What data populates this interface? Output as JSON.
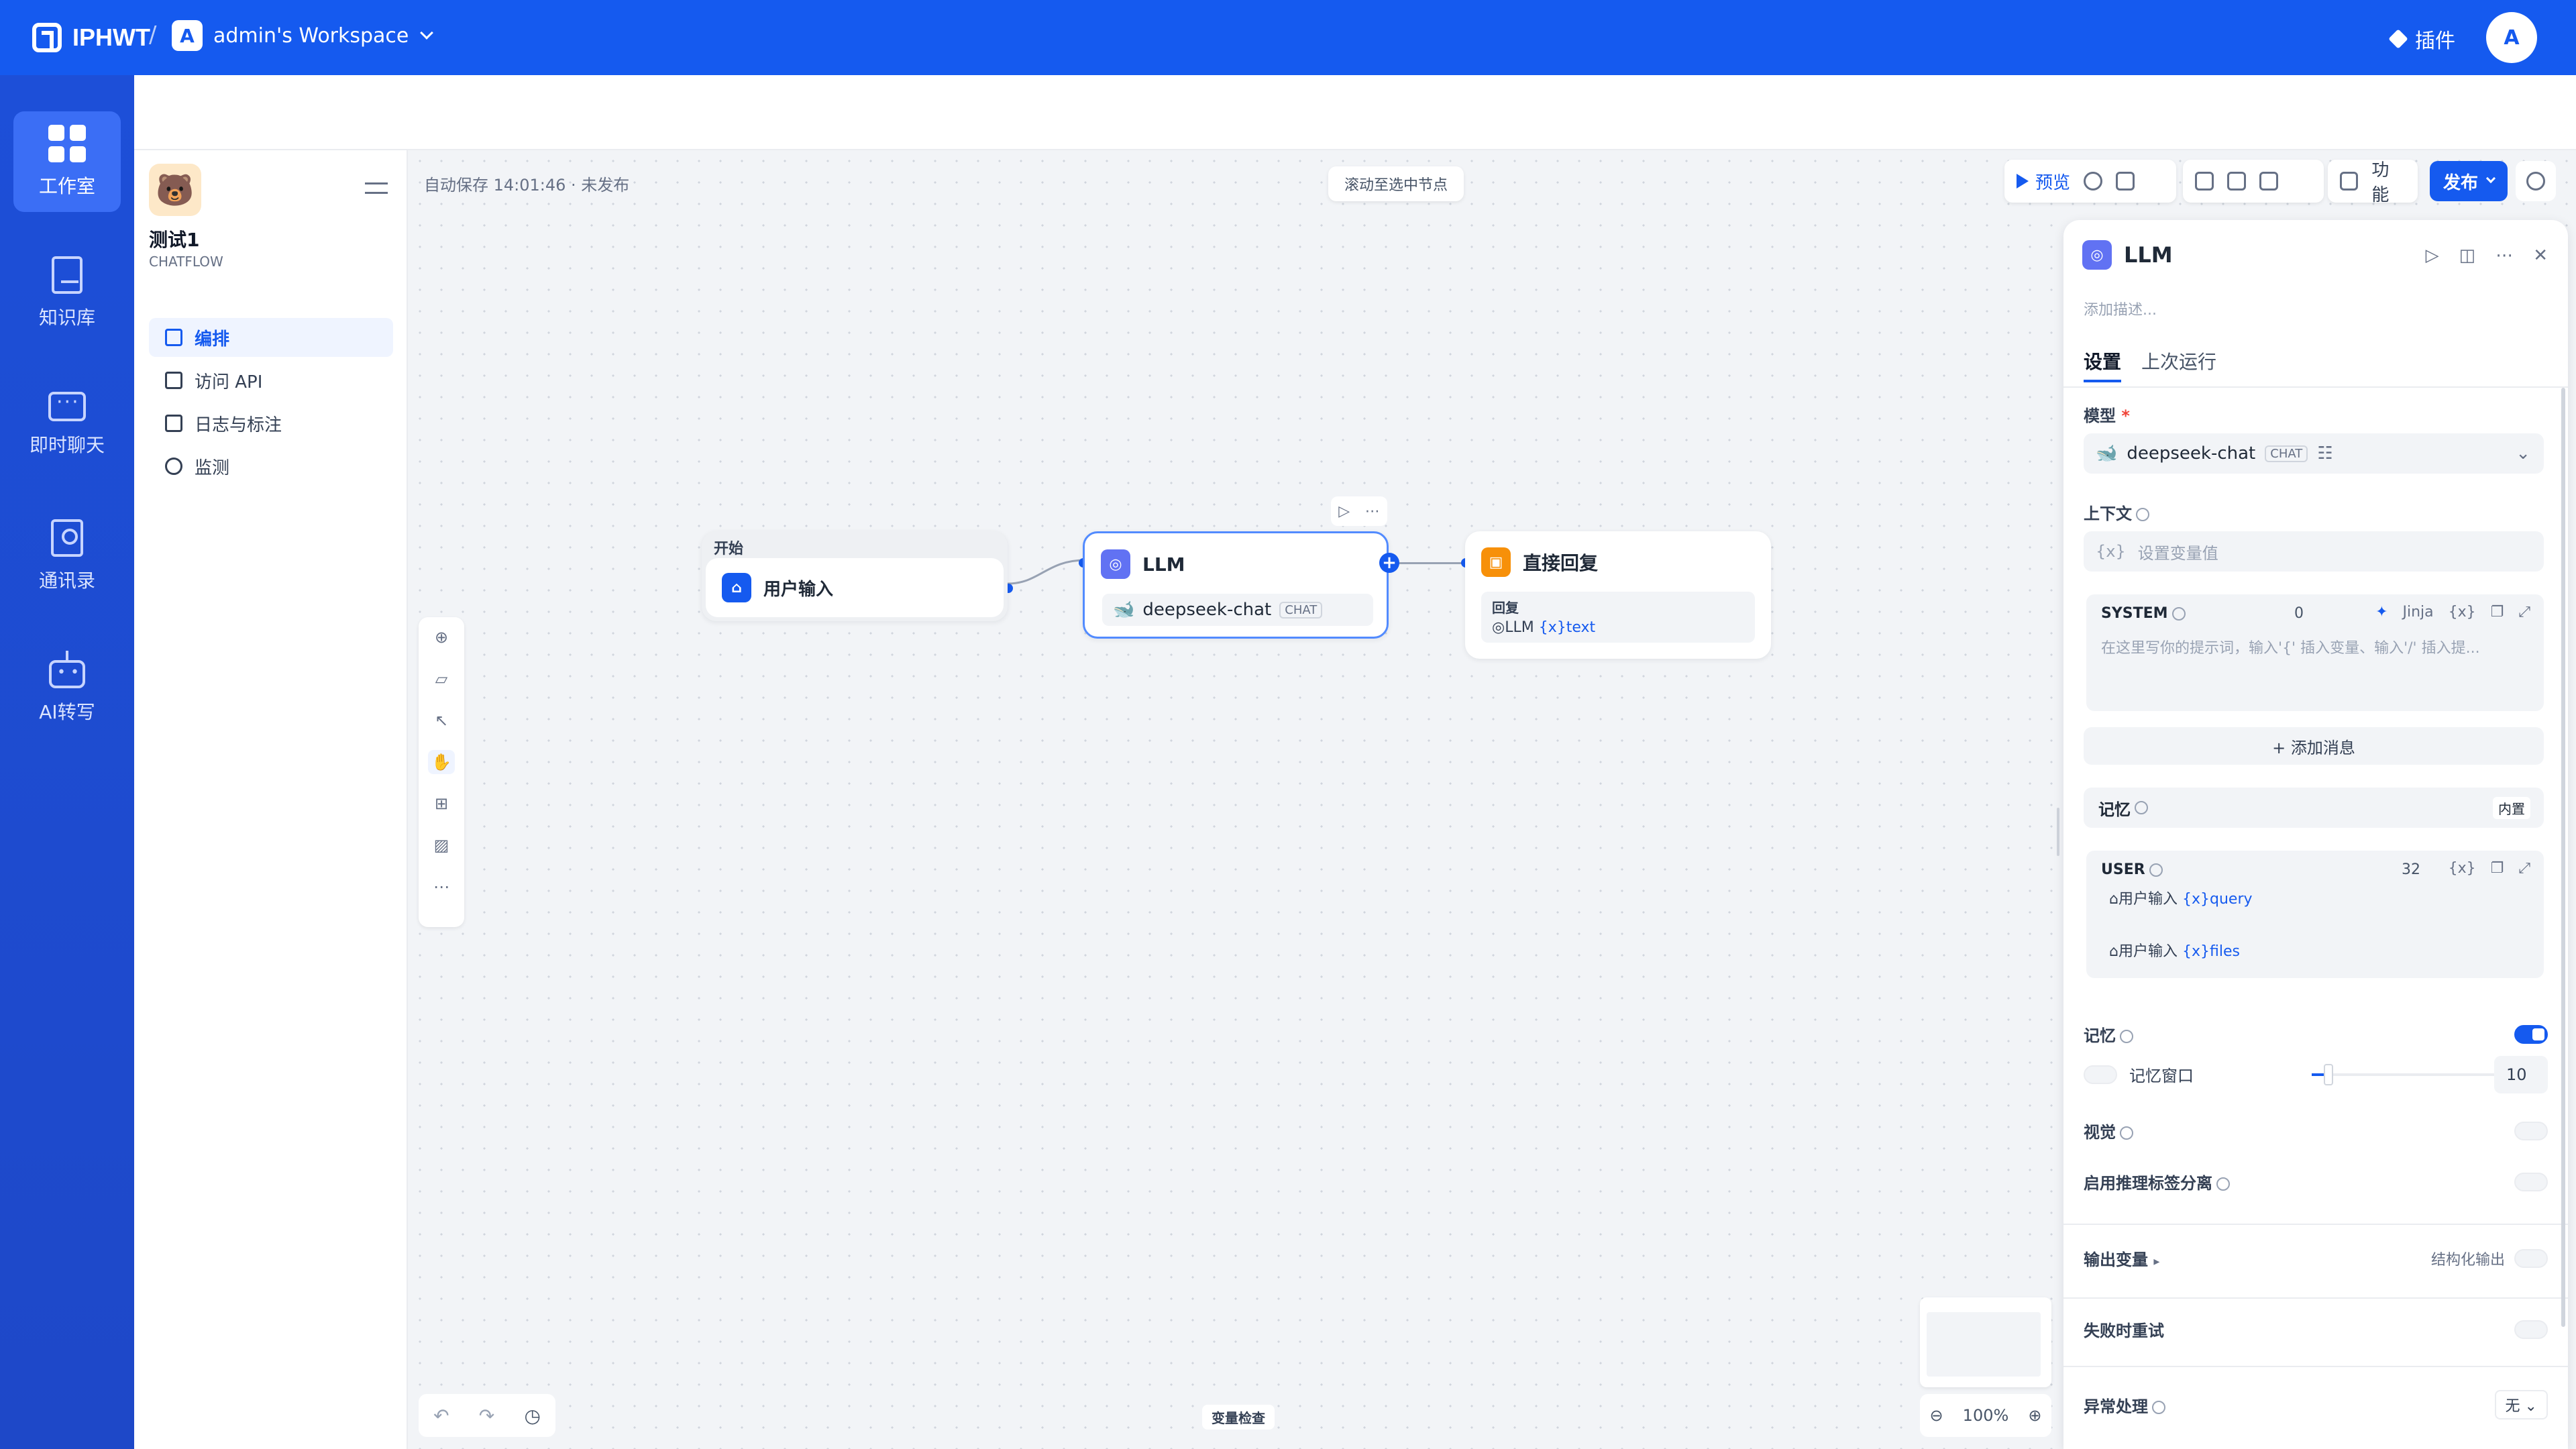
{
  "topbar": {
    "brand": "IPHWT",
    "separator": "/",
    "workspace_initial": "A",
    "workspace_name": "admin's Workspace",
    "plugins_label": "插件",
    "user_initial": "A"
  },
  "leftnav": {
    "items": [
      {
        "label": "工作室",
        "icon": "grid-icon"
      },
      {
        "label": "知识库",
        "icon": "book-icon"
      },
      {
        "label": "即时聊天",
        "icon": "chat-icon"
      },
      {
        "label": "通讯录",
        "icon": "contacts-icon"
      },
      {
        "label": "AI转写",
        "icon": "robot-icon"
      }
    ]
  },
  "app": {
    "name": "测试1",
    "type": "CHATFLOW",
    "menu": [
      {
        "label": "编排"
      },
      {
        "label": "访问 API"
      },
      {
        "label": "日志与标注"
      },
      {
        "label": "监测"
      }
    ]
  },
  "canvas": {
    "autosave": "自动保存 14:01:46 · 未发布",
    "scroll_to_node": "滚动至选中节点",
    "preview_label": "预览",
    "features_label": "功能",
    "publish_label": "发布",
    "variable_check": "变量检查",
    "zoom": "100%"
  },
  "nodes": {
    "start": {
      "header": "开始",
      "title": "用户输入"
    },
    "llm": {
      "title": "LLM",
      "model": "deepseek-chat",
      "model_tag": "CHAT"
    },
    "reply": {
      "title": "直接回复",
      "label": "回复",
      "ref_node": "LLM",
      "ref_var": "{x}text"
    }
  },
  "panel": {
    "title": "LLM",
    "description_placeholder": "添加描述...",
    "tabs": [
      "设置",
      "上次运行"
    ],
    "model_label": "模型",
    "model_required": "*",
    "model_name": "deepseek-chat",
    "model_tag": "CHAT",
    "context_label": "上下文",
    "context_prefix": "{x}",
    "context_placeholder": "设置变量值",
    "system_title": "SYSTEM",
    "system_count": "0",
    "system_jinja": "Jinja",
    "system_placeholder": "在这里写你的提示词，输入'{' 插入变量、输入'/' 插入提...",
    "add_message": "+ 添加消息",
    "memory_section": "记忆",
    "memory_builtin": "内置",
    "user_title": "USER",
    "user_count": "32",
    "user_line1_node": "用户输入",
    "user_line1_var": "{x}query",
    "user_line2_node": "用户输入",
    "user_line2_var": "{x}files",
    "memory_label": "记忆",
    "memory_window_label": "记忆窗口",
    "memory_window_value": 10,
    "vision_label": "视觉",
    "reasoning_label": "启用推理标签分离",
    "output_vars_label": "输出变量",
    "structured_output_label": "结构化输出",
    "retry_label": "失败时重试",
    "error_label": "异常处理",
    "error_value": "无"
  },
  "colors": {
    "primary": "#155aef",
    "nav": "#1d4fd8",
    "start_icon": "#155aef",
    "llm_icon": "#6172f3",
    "reply_icon": "#f79009"
  }
}
